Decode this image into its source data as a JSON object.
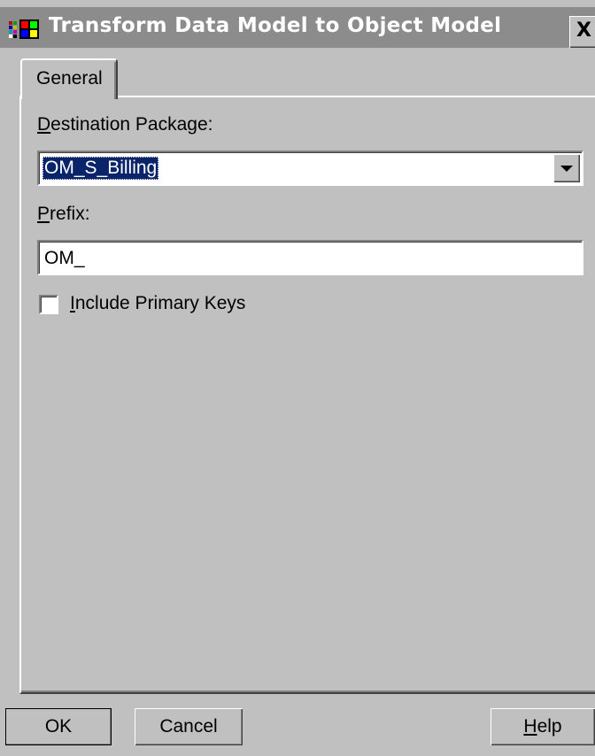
{
  "window": {
    "title": "Transform Data Model to Object Model",
    "close_symbol": "X",
    "icon": "app-multicolor-icon"
  },
  "tabs": [
    {
      "label": "General",
      "selected": true
    }
  ],
  "form": {
    "destination_package_label_underlined": "D",
    "destination_package_label_rest": "estination Package:",
    "destination_package_value": "OM_S_Billing",
    "prefix_label_underlined": "P",
    "prefix_label_rest": "refix:",
    "prefix_value": "OM_",
    "include_primary_keys_underlined": "I",
    "include_primary_keys_rest": "nclude Primary Keys",
    "include_primary_keys_checked": false
  },
  "buttons": {
    "ok": "OK",
    "cancel": "Cancel",
    "help_underlined": "H",
    "help_rest": "elp"
  },
  "colors": {
    "face": "#c0c0c0",
    "titlebar_inactive": "#8c8c8c",
    "selection": "#0a246a"
  }
}
